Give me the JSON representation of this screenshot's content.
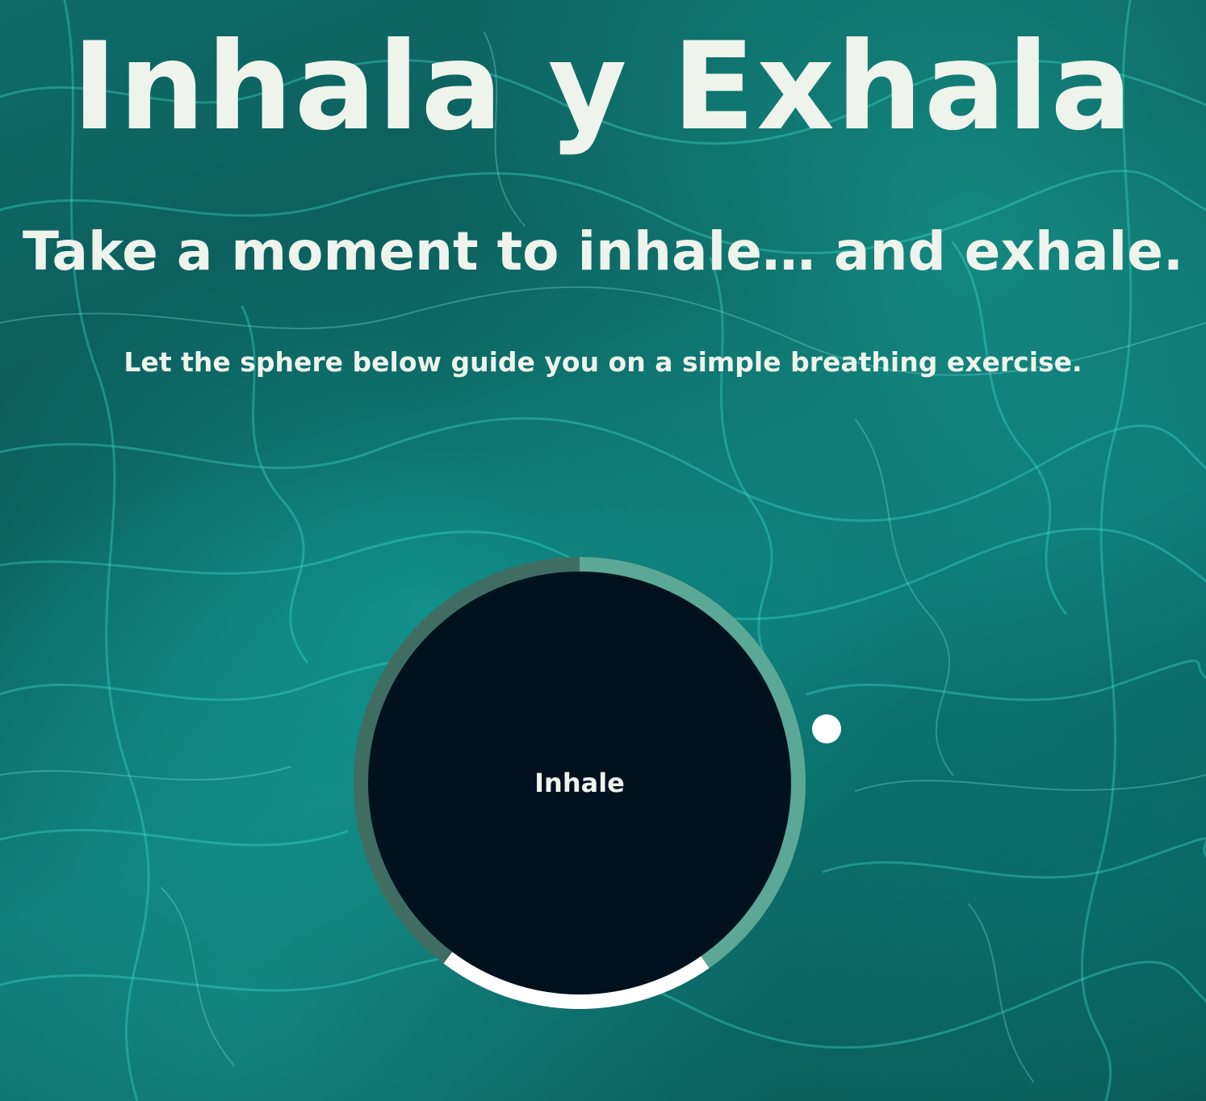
{
  "header": {
    "title": "Inhala y Exhala",
    "subtitle": "Take a moment to inhale… and exhale.",
    "instruction": "Let the sphere below guide you on a simple breathing exercise."
  },
  "breathing": {
    "phase_label": "Inhale",
    "ring_colors": {
      "hold_segment": "#3f6d62",
      "inhale_segment": "#5ba897",
      "exhale_segment": "#ffffff"
    },
    "sphere_color": "#02111e"
  },
  "theme": {
    "text_color": "#eef4ec",
    "background": "teal water"
  }
}
